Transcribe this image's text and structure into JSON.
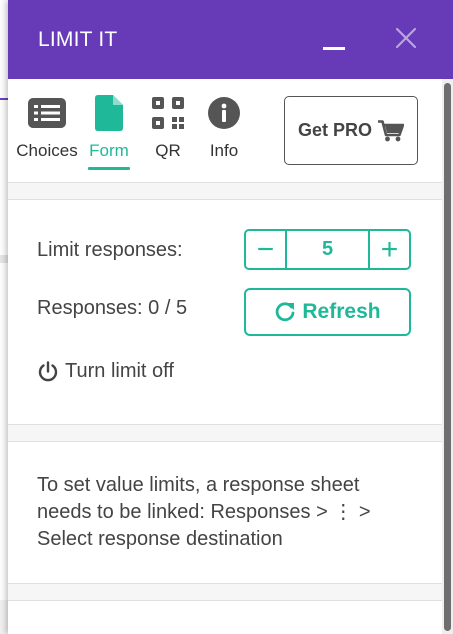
{
  "app": {
    "title": "LIMIT IT"
  },
  "tabs": [
    {
      "label": "Choices",
      "icon": "list-icon",
      "active": false
    },
    {
      "label": "Form",
      "icon": "document-icon",
      "active": true
    },
    {
      "label": "QR",
      "icon": "qr-code-icon",
      "active": false
    },
    {
      "label": "Info",
      "icon": "info-icon",
      "active": false
    }
  ],
  "get_pro": {
    "label": "Get PRO",
    "icon": "cart-icon"
  },
  "limit": {
    "label": "Limit responses:",
    "value": "5",
    "minus_label": "−",
    "plus_label": "+"
  },
  "responses": {
    "label": "Responses: 0 / 5"
  },
  "refresh": {
    "label": "Refresh",
    "icon": "refresh-icon"
  },
  "turn_off": {
    "label": "Turn limit off",
    "icon": "power-icon"
  },
  "info_text": "To set value limits, a response sheet needs to be linked: Responses > ⋮ > Select response destination",
  "colors": {
    "header": "#673ab7",
    "accent": "#1fb99a",
    "text": "#444444"
  }
}
